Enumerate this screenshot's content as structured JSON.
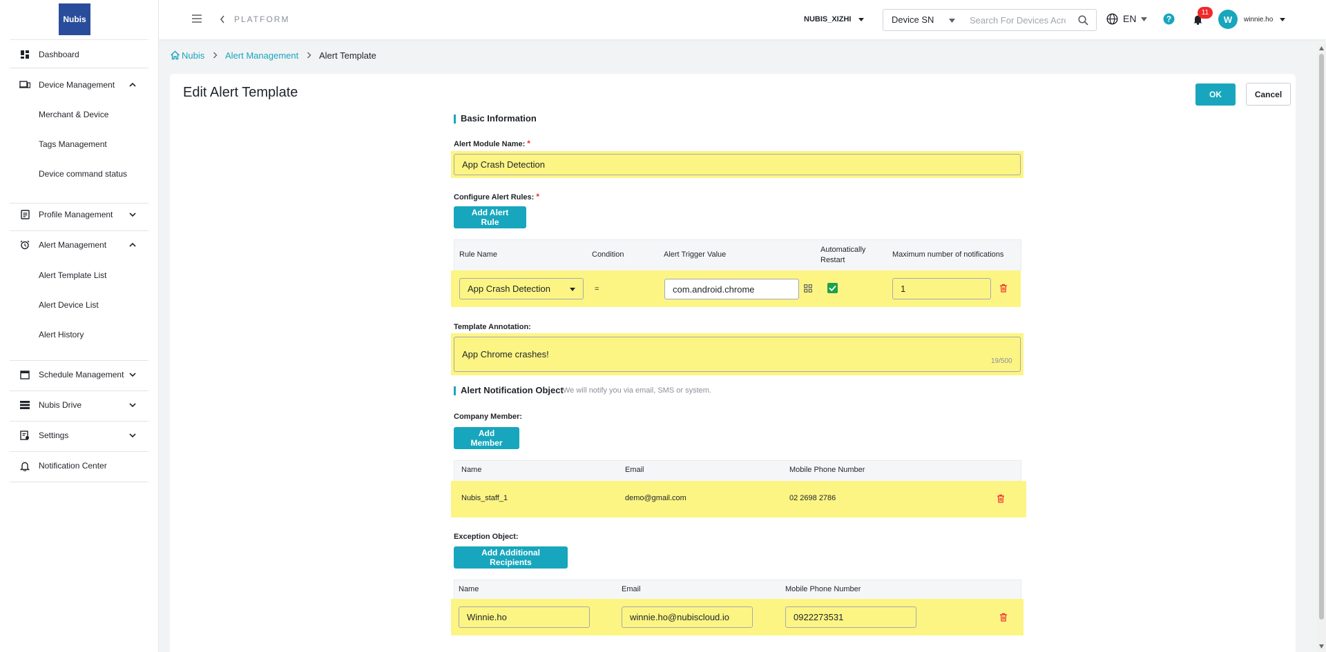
{
  "sidebar": {
    "logo_text": "Nubis",
    "items": [
      {
        "label": "Dashboard",
        "icon": "dashboard-icon"
      },
      {
        "label": "Device Management",
        "icon": "devices-icon",
        "expanded": true,
        "children": [
          "Merchant & Device",
          "Tags Management",
          "Device command status"
        ]
      },
      {
        "label": "Profile Management",
        "icon": "profile-icon",
        "expanded": false
      },
      {
        "label": "Alert Management",
        "icon": "alarm-clock-icon",
        "expanded": true,
        "children": [
          "Alert Template List",
          "Alert Device List",
          "Alert History"
        ]
      },
      {
        "label": "Schedule Management",
        "icon": "calendar-icon",
        "expanded": false
      },
      {
        "label": "Nubis Drive",
        "icon": "storage-icon",
        "expanded": false
      },
      {
        "label": "Settings",
        "icon": "settings-doc-icon",
        "expanded": false
      },
      {
        "label": "Notification Center",
        "icon": "bell-icon"
      }
    ]
  },
  "header": {
    "platform": "PLATFORM",
    "org": "NUBIS_XIZHI",
    "search_type": "Device SN",
    "search_placeholder": "Search For Devices Across",
    "lang": "EN",
    "notification_count": "11",
    "avatar_letter": "W",
    "username": "winnie.ho"
  },
  "breadcrumb": {
    "home": "Nubis",
    "parent": "Alert Management",
    "current": "Alert Template"
  },
  "page": {
    "title": "Edit Alert Template",
    "ok_label": "OK",
    "cancel_label": "Cancel",
    "basic_info_title": "Basic Information",
    "module_name_label": "Alert Module Name:",
    "module_name_value": "App Crash Detection",
    "rules_label": "Configure Alert Rules:",
    "add_rule_label": "Add Alert Rule",
    "rules_table": {
      "headers": [
        "Rule Name",
        "Condition",
        "Alert Trigger Value",
        "Automatically Restart",
        "Maximum number of notifications"
      ],
      "row": {
        "rule_name": "App Crash Detection",
        "condition": "=",
        "trigger_value": "com.android.chrome",
        "auto_restart": true,
        "max_notifications": "1"
      }
    },
    "annotation_label": "Template Annotation:",
    "annotation_value": "App Chrome crashes!",
    "annotation_counter": "19/500",
    "notify_title": "Alert Notification Object",
    "notify_note": "We will notify you via email, SMS or system.",
    "company_member_label": "Company Member:",
    "add_member_label": "Add Member",
    "members_table": {
      "headers": [
        "Name",
        "Email",
        "Mobile Phone Number"
      ],
      "rows": [
        {
          "name": "Nubis_staff_1",
          "email": "demo@gmail.com",
          "phone": "02 2698 2786"
        }
      ]
    },
    "exception_label": "Exception Object:",
    "add_recipients_label": "Add Additional Recipients",
    "exception_table": {
      "headers": [
        "Name",
        "Email",
        "Mobile Phone Number"
      ],
      "rows": [
        {
          "name": "Winnie.ho",
          "email": "winnie.ho@nubiscloud.io",
          "phone": "0922273531"
        }
      ]
    }
  },
  "colors": {
    "accent": "#17a6bd",
    "highlight": "#fcf584",
    "danger": "#f0292a",
    "brand_logo": "#2a4d9b"
  }
}
